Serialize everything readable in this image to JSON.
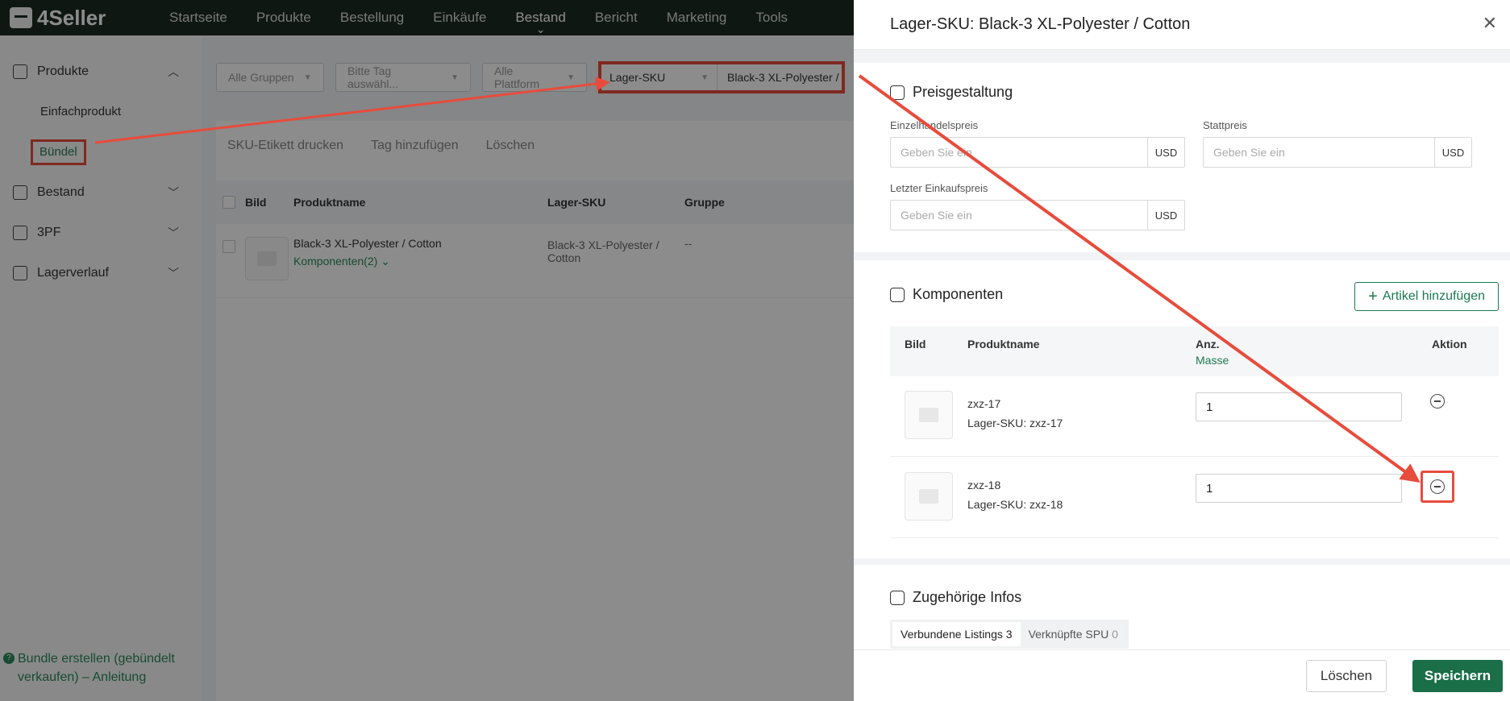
{
  "app": {
    "logo": "4Seller"
  },
  "nav": [
    "Startseite",
    "Produkte",
    "Bestellung",
    "Einkäufe",
    "Bestand",
    "Bericht",
    "Marketing",
    "Tools"
  ],
  "sidebar": {
    "groups": [
      {
        "label": "Produkte",
        "expanded": true,
        "items": [
          "Einfachprodukt",
          "Bündel"
        ],
        "selected": "Bündel"
      },
      {
        "label": "Bestand"
      },
      {
        "label": "3PF"
      },
      {
        "label": "Lagerverlauf"
      }
    ],
    "help_link": "Bundle erstellen (gebündelt verkaufen) – Anleitung"
  },
  "filters": {
    "group": "Alle Gruppen",
    "tag": "Bitte Tag auswähl...",
    "platform": "Alle Plattform",
    "search_type": "Lager-SKU",
    "search_value": "Black-3 XL-Polyester /"
  },
  "toolbar": [
    "SKU-Etikett drucken",
    "Tag hinzufügen",
    "Löschen"
  ],
  "table": {
    "headers": [
      "Bild",
      "Produktname",
      "Lager-SKU",
      "Gruppe"
    ],
    "rows": [
      {
        "name": "Black-3 XL-Polyester / Cotton",
        "components_link": "Komponenten(2)",
        "sku": "Black-3 XL-Polyester / Cotton",
        "group": "--"
      }
    ]
  },
  "drawer": {
    "title": "Lager-SKU: Black-3 XL-Polyester / Cotton",
    "pricing": {
      "title": "Preisgestaltung",
      "retail_label": "Einzelhandelspreis",
      "list_label": "Stattpreis",
      "last_purchase_label": "Letzter Einkaufspreis",
      "placeholder": "Geben Sie ein",
      "currency": "USD"
    },
    "components": {
      "title": "Komponenten",
      "add_button": "Artikel hinzufügen",
      "headers": {
        "image": "Bild",
        "name": "Produktname",
        "qty": "Anz.",
        "qty_link": "Masse",
        "action": "Aktion"
      },
      "rows": [
        {
          "name": "zxz-17",
          "sku": "Lager-SKU: zxz-17",
          "qty": "1"
        },
        {
          "name": "zxz-18",
          "sku": "Lager-SKU: zxz-18",
          "qty": "1"
        }
      ]
    },
    "related": {
      "title": "Zugehörige Infos",
      "tabs": [
        {
          "label": "Verbundene Listings",
          "count": "3"
        },
        {
          "label": "Verknüpfte SPU",
          "count": "0"
        }
      ]
    },
    "footer": {
      "delete": "Löschen",
      "save": "Speichern"
    }
  },
  "colors": {
    "brand": "#1a6e48",
    "highlight": "#e74c3c",
    "nav_bg": "#1d2b24"
  }
}
